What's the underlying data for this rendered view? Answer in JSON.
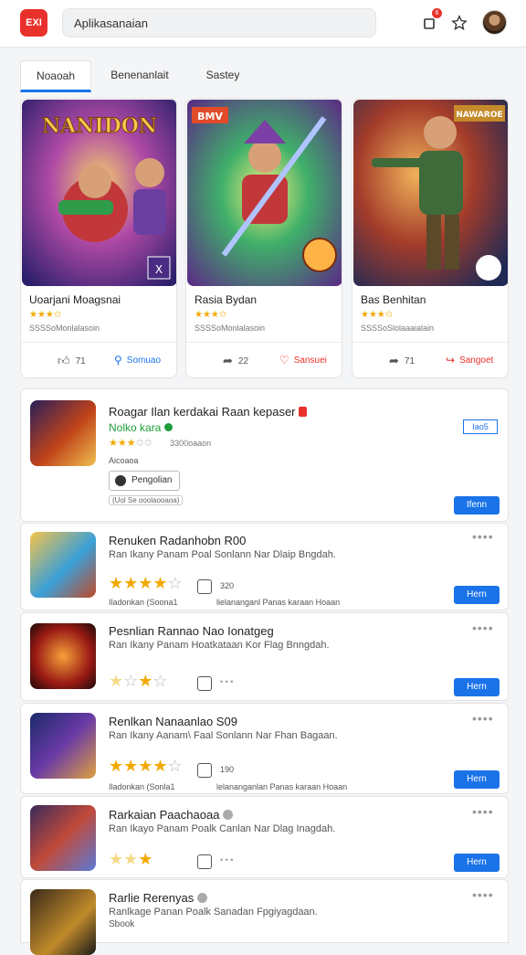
{
  "header": {
    "logo": "EXI",
    "search_value": "Aplikasanaian",
    "notification_count": "6",
    "icons": [
      "app-logo-icon",
      "notification-icon",
      "favorites-icon",
      "user-avatar"
    ]
  },
  "tabs": [
    {
      "label": "Noaoah",
      "active": true
    },
    {
      "label": "Benenanlait",
      "active": false
    },
    {
      "label": "Sastey",
      "active": false
    }
  ],
  "featured": [
    {
      "title": "Uoarjani Moagsnai",
      "stars": "★★★✩",
      "count": "SSSSoMonlalasoin",
      "like_count": "71",
      "action_label": "Somuao",
      "action_color": "#1a73e8",
      "art_label": "NANIDON",
      "art_badge": "X"
    },
    {
      "title": "Rasia Bydan",
      "stars": "★★★✩",
      "count": "SSSSoMonlalasoin",
      "like_count": "22",
      "action_label": "Sansuei",
      "action_color": "#e8312b",
      "art_label": "BMV",
      "art_badge": ""
    },
    {
      "title": "Bas Benhitan",
      "stars": "★★★✩",
      "count": "SSSSoSlolaaaialain",
      "like_count": "71",
      "action_label": "Sangoet",
      "action_color": "#e8312b",
      "art_label": "NAWAROE",
      "art_badge": ""
    }
  ],
  "list": [
    {
      "title": "Roagar Ilan kerdakai Raan kepaser",
      "subtitle": "Nolko kara",
      "stars_on": 3,
      "stars_off": 2,
      "count": "3300oaaon",
      "meta": "Aicoaoa",
      "chip": "Pengolian",
      "footnote": "(Uol Se ooolaooaoa)",
      "button": "Ifenn",
      "side_badge": "Iao5"
    },
    {
      "title": "Renuken Radanhobn  R00",
      "subtitle": "Ran Ikany Panam Poal Sonlann Nar Dlaip Bngdah.",
      "stars_on": 4,
      "stars_off": 1,
      "num": "320",
      "meta_a": "Iladonkan (Soona1",
      "meta_b": "lielananganl Panas karaan Hoaan",
      "button": "Hern"
    },
    {
      "title": "Pesnlian Rannao Nao Ionatgeg",
      "subtitle": "Ran Ikany Panam Hoatkataan Kor Flag Bnngdah.",
      "stars_on": 2,
      "stars_off": 1,
      "num": "",
      "button": "Hern"
    },
    {
      "title": "Renlkan Nanaanlao  S09",
      "subtitle": "Ran Ikany Aanam\\ Faal Sonlann Nar Fhan Bagaan.",
      "stars_on": 4,
      "stars_off": 1,
      "num": "190",
      "meta_a": "Iladonkan (Sonla1",
      "meta_b": "lelananganlan Panas karaan Hoaan",
      "button": "Hern"
    },
    {
      "title": "Rarkaian Paachaoaa",
      "subtitle": "Ran Ikayo Panam Poalk Canlan Nar Dlag Inagdah.",
      "stars_on": 3,
      "stars_off": 0,
      "num": "",
      "button": "Hern"
    },
    {
      "title": "Rarlie Rerenyas",
      "subtitle": "Ranlkage Panan Poalk Sanadan Fpgiyagdaan.",
      "extra": "Sbook",
      "button": ""
    }
  ],
  "colors": {
    "accent": "#1a73e8",
    "brand": "#e8312b",
    "star": "#f2a900"
  }
}
